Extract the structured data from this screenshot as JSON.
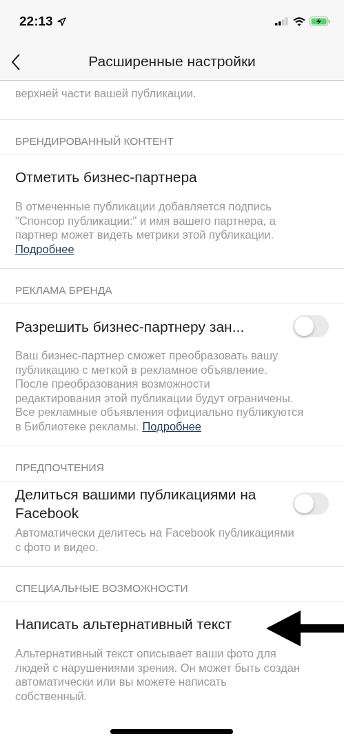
{
  "status_bar": {
    "time": "22:13"
  },
  "nav": {
    "title": "Расширенные настройки"
  },
  "intro": [
    [
      {
        "kind": "text",
        "text": "верхней части вашей публикации."
      }
    ]
  ],
  "sections": [
    {
      "header": "БРЕНДИРОВАННЫЙ КОНТЕНТ",
      "row": {
        "kind": "link",
        "label": "Отметить бизнес-партнера"
      },
      "description": [
        [
          {
            "kind": "text",
            "text": "В отмеченные публикации добавляется подпись"
          }
        ],
        [
          {
            "kind": "text",
            "text": "\"Спонсор публикации:\" и имя вашего партнера, а"
          }
        ],
        [
          {
            "kind": "text",
            "text": "партнер может видеть метрики этой публикации."
          }
        ],
        [
          {
            "kind": "link",
            "text": "Подробнее"
          }
        ]
      ]
    },
    {
      "header": "РЕКЛАМА БРЕНДА",
      "row": {
        "kind": "toggle",
        "label": "Разрешить бизнес-партнеру зан...",
        "on": false
      },
      "description": [
        [
          {
            "kind": "text",
            "text": "Ваш бизнес-партнер сможет преобразовать вашу"
          }
        ],
        [
          {
            "kind": "text",
            "text": "публикацию с меткой в рекламное объявление."
          }
        ],
        [
          {
            "kind": "text",
            "text": "После преобразования возможности"
          }
        ],
        [
          {
            "kind": "text",
            "text": "редактирования этой публикации будут ограничены."
          }
        ],
        [
          {
            "kind": "text",
            "text": "Все рекламные объявления официально публикуются"
          }
        ],
        [
          {
            "kind": "text",
            "text": "в Библиотеке рекламы."
          },
          {
            "kind": "link",
            "text": "Подробнее"
          }
        ]
      ]
    },
    {
      "header": "ПРЕДПОЧТЕНИЯ",
      "row": {
        "kind": "toggle",
        "label": "Делиться вашими публикациями на Facebook",
        "on": false
      },
      "description": [
        [
          {
            "kind": "text",
            "text": "Автоматически делитесь на Facebook публикациями"
          }
        ],
        [
          {
            "kind": "text",
            "text": "с фото и видео."
          }
        ]
      ]
    },
    {
      "header": "СПЕЦИАЛЬНЫЕ ВОЗМОЖНОСТИ",
      "row": {
        "kind": "link",
        "label": "Написать альтернативный текст"
      },
      "description": [
        [
          {
            "kind": "text",
            "text": "Альтернативный текст описывает ваши фото для"
          }
        ],
        [
          {
            "kind": "text",
            "text": "людей с нарушениями зрения. Он может быть создан"
          }
        ],
        [
          {
            "kind": "text",
            "text": "автоматически или вы можете написать"
          }
        ],
        [
          {
            "kind": "text",
            "text": "собственный."
          }
        ]
      ]
    }
  ]
}
